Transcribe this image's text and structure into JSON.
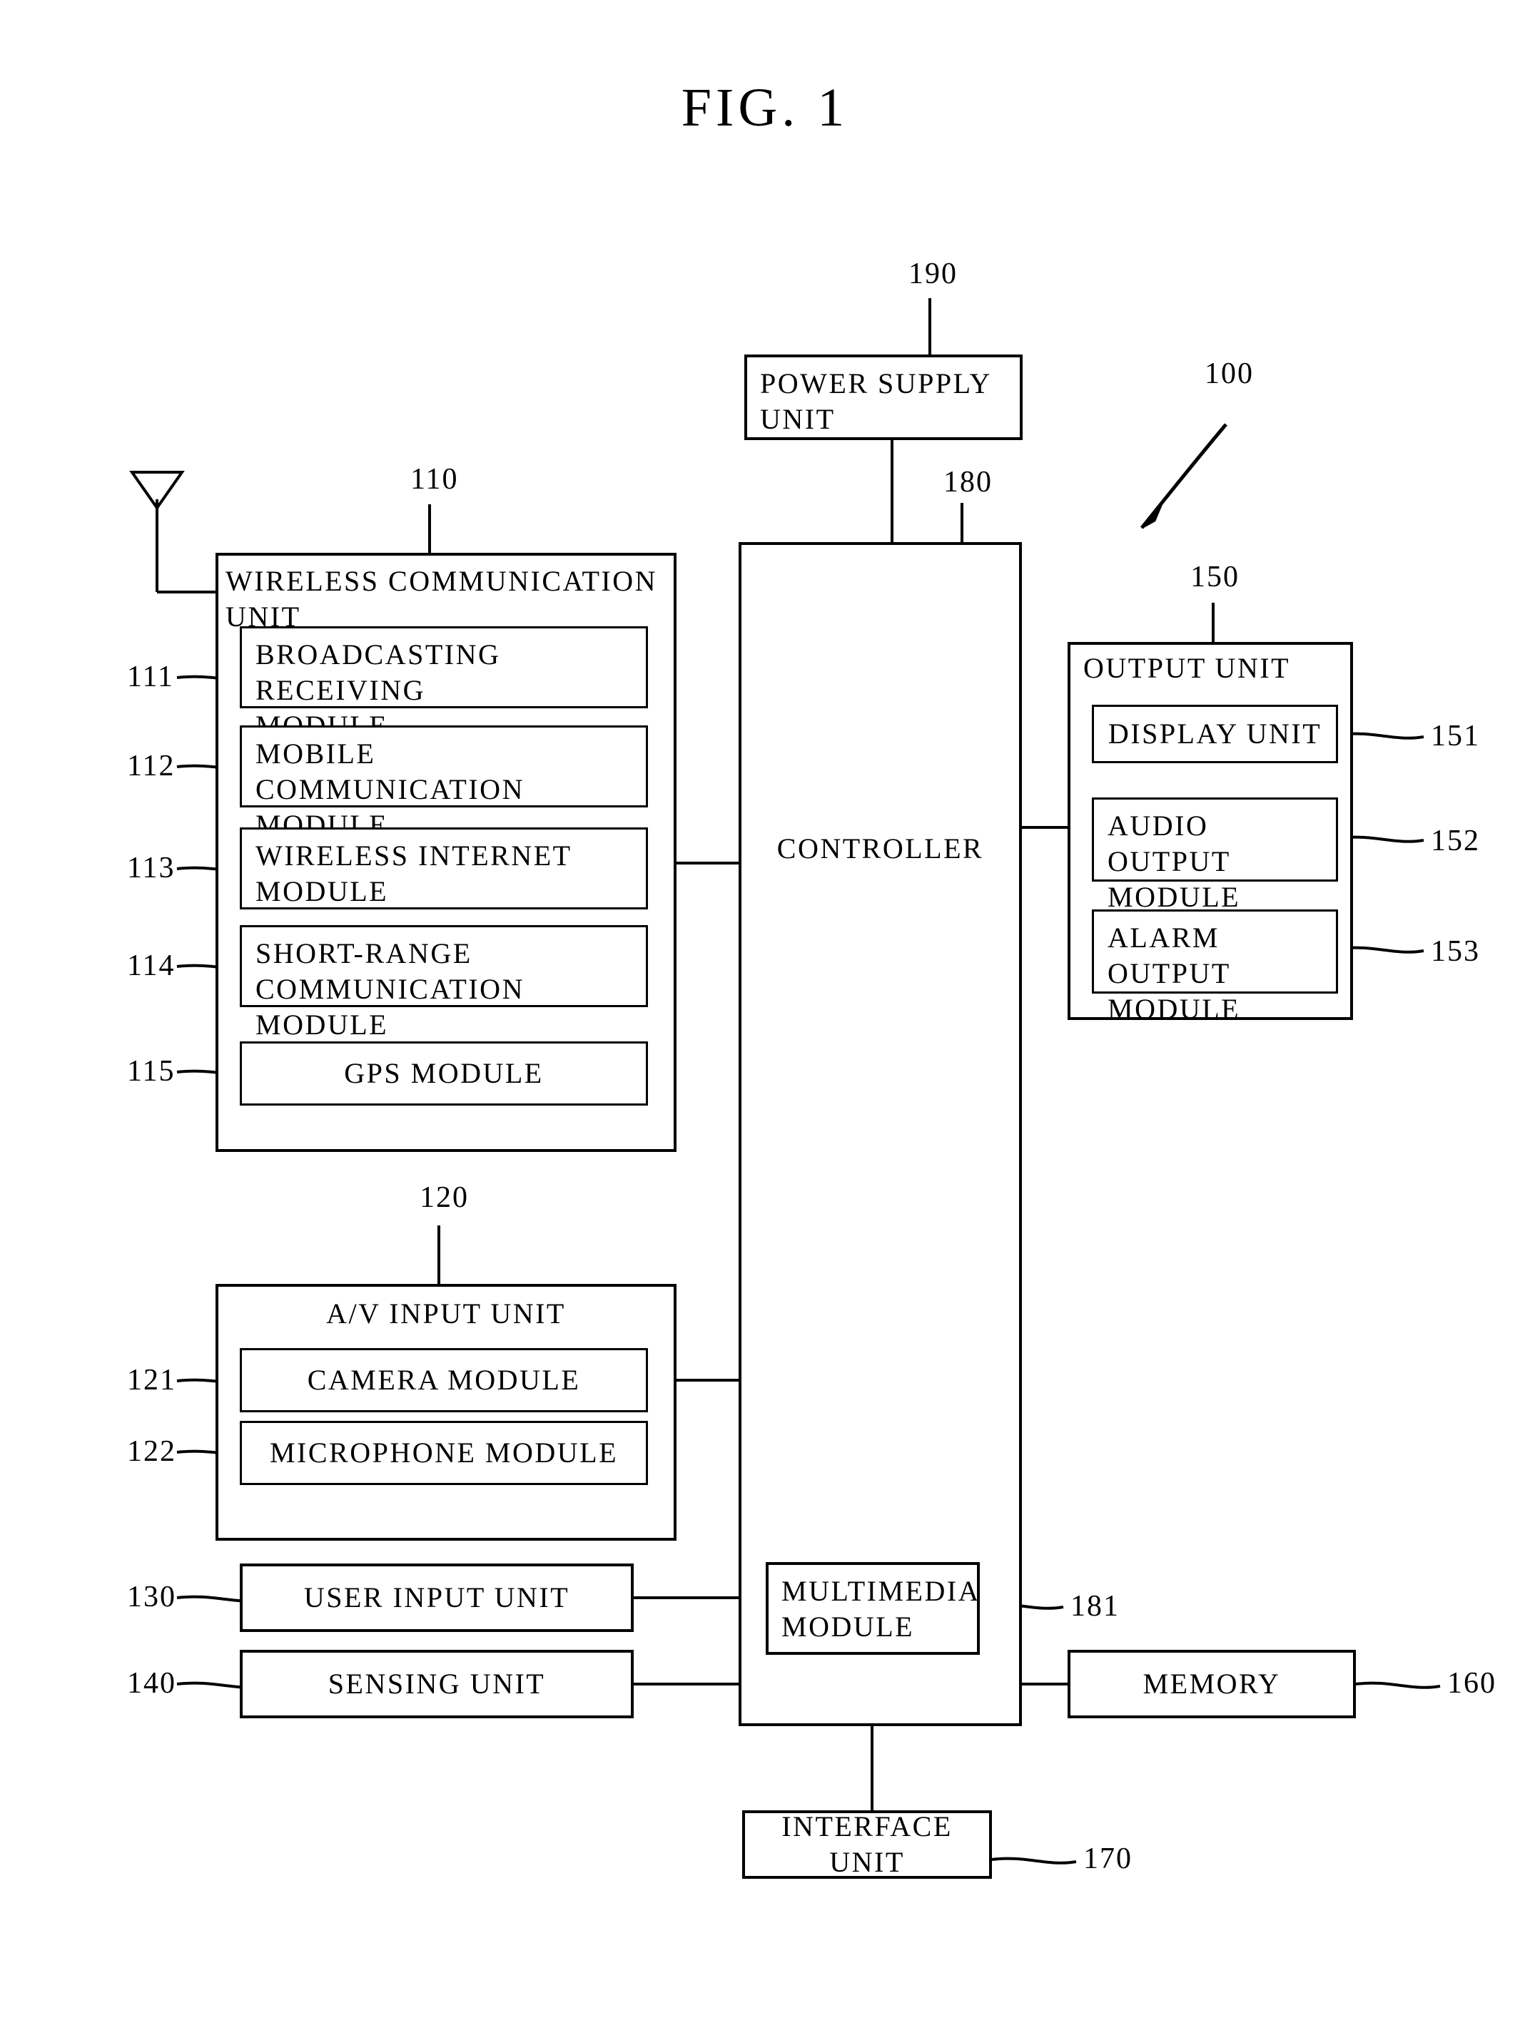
{
  "figure": {
    "title": "FIG.  1",
    "system_ref": "100"
  },
  "blocks": {
    "power_supply": {
      "label": "POWER SUPPLY\nUNIT",
      "ref": "190"
    },
    "controller": {
      "label": "CONTROLLER",
      "ref": "180"
    },
    "multimedia": {
      "label": "MULTIMEDIA\nMODULE",
      "ref": "181"
    },
    "wireless_unit": {
      "label": "WIRELESS COMMUNICATION UNIT",
      "ref": "110",
      "modules": [
        {
          "label": "BROADCASTING  RECEIVING\nMODULE",
          "ref": "111",
          "align": "left"
        },
        {
          "label": "MOBILE COMMUNICATION\nMODULE",
          "ref": "112",
          "align": "left"
        },
        {
          "label": "WIRELESS  INTERNET\nMODULE",
          "ref": "113",
          "align": "left"
        },
        {
          "label": "SHORT-RANGE\nCOMMUNICATION  MODULE",
          "ref": "114",
          "align": "left"
        },
        {
          "label": "GPS  MODULE",
          "ref": "115",
          "align": "center"
        }
      ]
    },
    "av_input_unit": {
      "label": "A/V INPUT UNIT",
      "ref": "120",
      "modules": [
        {
          "label": "CAMERA  MODULE",
          "ref": "121",
          "align": "center"
        },
        {
          "label": "MICROPHONE MODULE",
          "ref": "122",
          "align": "center"
        }
      ]
    },
    "output_unit": {
      "label": "OUTPUT UNIT",
      "ref": "150",
      "modules": [
        {
          "label": "DISPLAY UNIT",
          "ref": "151",
          "align": "center"
        },
        {
          "label": "AUDIO OUTPUT\nMODULE",
          "ref": "152",
          "align": "left"
        },
        {
          "label": "ALARM OUTPUT\nMODULE",
          "ref": "153",
          "align": "left"
        }
      ]
    },
    "user_input_unit": {
      "label": "USER INPUT UNIT",
      "ref": "130"
    },
    "sensing_unit": {
      "label": "SENSING UNIT",
      "ref": "140"
    },
    "memory": {
      "label": "MEMORY",
      "ref": "160"
    },
    "interface_unit": {
      "label": "INTERFACE UNIT",
      "ref": "170"
    }
  },
  "icons": {
    "antenna": "antenna-icon"
  }
}
